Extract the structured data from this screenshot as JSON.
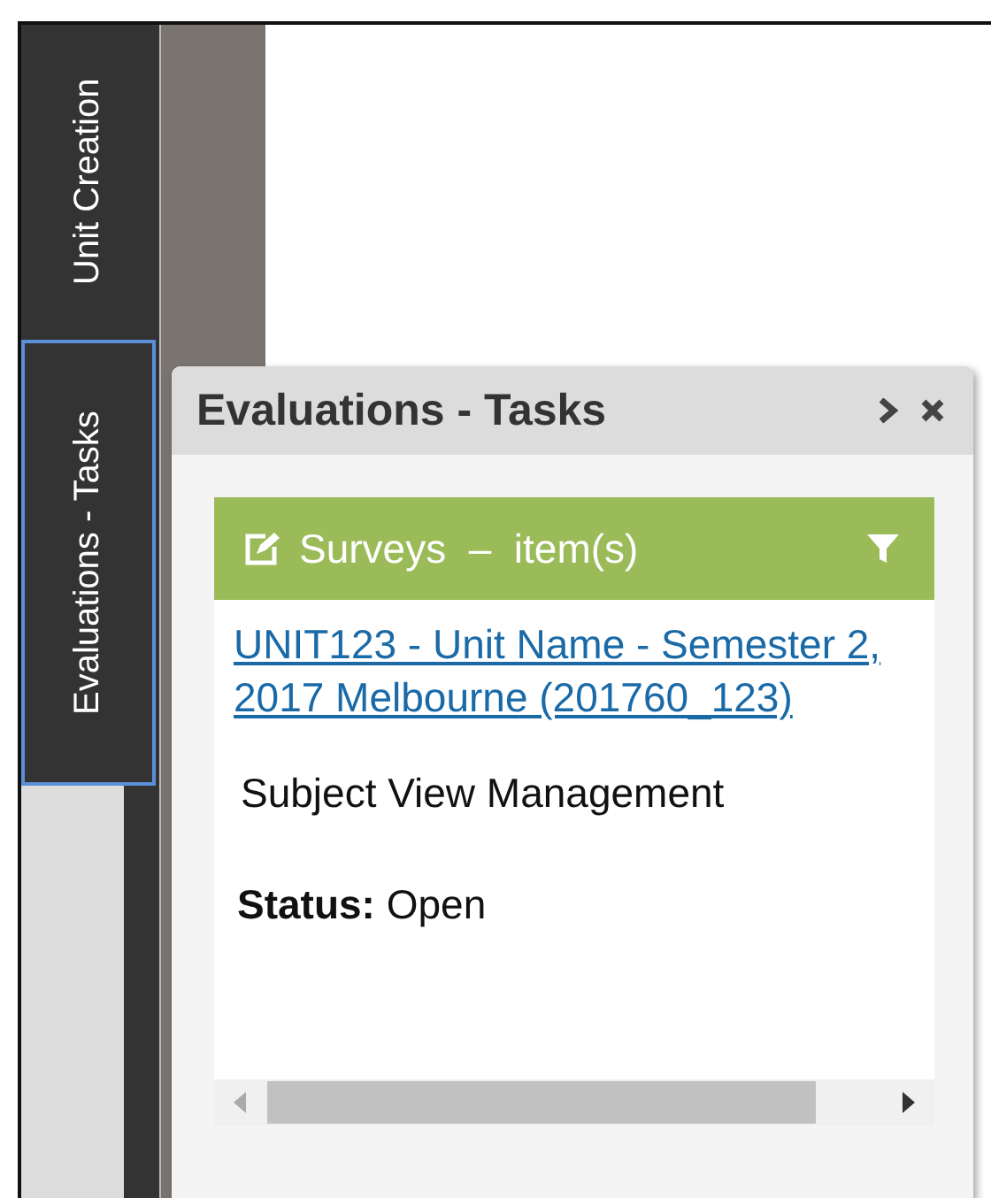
{
  "side_tabs": [
    {
      "label": "Unit Creation",
      "selected": false
    },
    {
      "label": "Evaluations - Tasks",
      "selected": true
    }
  ],
  "panel": {
    "title": "Evaluations - Tasks",
    "section": {
      "title": "Surveys  –  item(s)"
    },
    "item": {
      "link": "UNIT123 - Unit Name - Semester 2, 2017 Melbourne (201760_123)",
      "description": "Subject View Management",
      "status_label": "Status:",
      "status": "Open"
    }
  }
}
